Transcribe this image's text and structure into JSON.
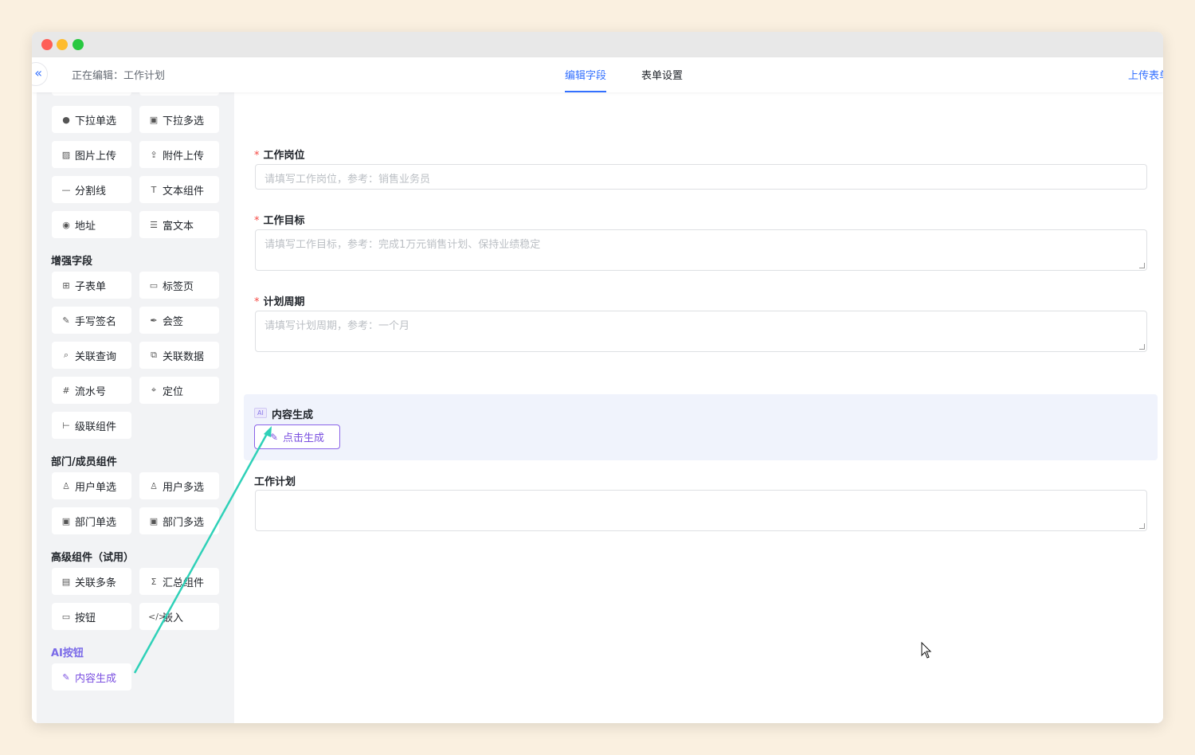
{
  "topbar": {
    "collapse_icon": "«",
    "editing_label": "正在编辑：工作计划",
    "tabs": [
      {
        "label": "编辑字段",
        "active": true
      },
      {
        "label": "表单设置",
        "active": false
      }
    ],
    "upload_label": "上传表单"
  },
  "sidebar": {
    "basic_items": [
      {
        "label": "下拉单选",
        "icon": "dropdown-single-icon",
        "glyph": "●"
      },
      {
        "label": "下拉多选",
        "icon": "dropdown-multi-icon",
        "glyph": "▣"
      },
      {
        "label": "图片上传",
        "icon": "image-upload-icon",
        "glyph": "▨"
      },
      {
        "label": "附件上传",
        "icon": "attachment-upload-icon",
        "glyph": "⇪"
      },
      {
        "label": "分割线",
        "icon": "divider-icon",
        "glyph": "—"
      },
      {
        "label": "文本组件",
        "icon": "text-component-icon",
        "glyph": "T"
      },
      {
        "label": "地址",
        "icon": "location-pin-icon",
        "glyph": "◉"
      },
      {
        "label": "富文本",
        "icon": "rich-text-icon",
        "glyph": "☰"
      }
    ],
    "enhanced_title": "增强字段",
    "enhanced_items": [
      {
        "label": "子表单",
        "icon": "subform-icon",
        "glyph": "⊞"
      },
      {
        "label": "标签页",
        "icon": "tabs-icon",
        "glyph": "▭"
      },
      {
        "label": "手写签名",
        "icon": "pen-icon",
        "glyph": "✎"
      },
      {
        "label": "会签",
        "icon": "feather-icon",
        "glyph": "✒"
      },
      {
        "label": "关联查询",
        "icon": "related-query-icon",
        "glyph": "⌕"
      },
      {
        "label": "关联数据",
        "icon": "related-data-icon",
        "glyph": "⧉"
      },
      {
        "label": "流水号",
        "icon": "hash-icon",
        "glyph": "#"
      },
      {
        "label": "定位",
        "icon": "crosshair-icon",
        "glyph": "⌖"
      },
      {
        "label": "级联组件",
        "icon": "cascade-icon",
        "glyph": "⊢"
      }
    ],
    "dept_title": "部门/成员组件",
    "dept_items": [
      {
        "label": "用户单选",
        "icon": "user-icon",
        "glyph": "♙"
      },
      {
        "label": "用户多选",
        "icon": "users-icon",
        "glyph": "♙"
      },
      {
        "label": "部门单选",
        "icon": "department-icon",
        "glyph": "▣"
      },
      {
        "label": "部门多选",
        "icon": "departments-icon",
        "glyph": "▣"
      }
    ],
    "advanced_title": "高级组件（试用）",
    "advanced_items": [
      {
        "label": "关联多条",
        "icon": "related-multiple-icon",
        "glyph": "▤"
      },
      {
        "label": "汇总组件",
        "icon": "sigma-icon",
        "glyph": "Σ"
      },
      {
        "label": "按钮",
        "icon": "button-icon",
        "glyph": "▭"
      },
      {
        "label": "嵌入",
        "icon": "code-icon",
        "glyph": "</>"
      }
    ],
    "ai_title": "AI按钮",
    "ai_items": [
      {
        "label": "内容生成",
        "icon": "edit-square-icon",
        "glyph": "✎"
      }
    ]
  },
  "form": {
    "fields": [
      {
        "label": "工作岗位",
        "required": true,
        "placeholder": "请填写工作岗位，参考：销售业务员"
      },
      {
        "label": "工作目标",
        "required": true,
        "placeholder": "请填写工作目标，参考：完成1万元销售计划、保持业绩稳定"
      },
      {
        "label": "计划周期",
        "required": true,
        "placeholder": "请填写计划周期，参考：一个月"
      }
    ],
    "ai_block": {
      "badge": "AI",
      "title": "内容生成",
      "button_label": "点击生成"
    },
    "output_field": {
      "label": "工作计划",
      "placeholder": ""
    }
  },
  "colors": {
    "accent": "#3370ff",
    "ai_purple": "#7a4fe0",
    "required": "#f54a45",
    "arrow": "#2fd1b8"
  }
}
